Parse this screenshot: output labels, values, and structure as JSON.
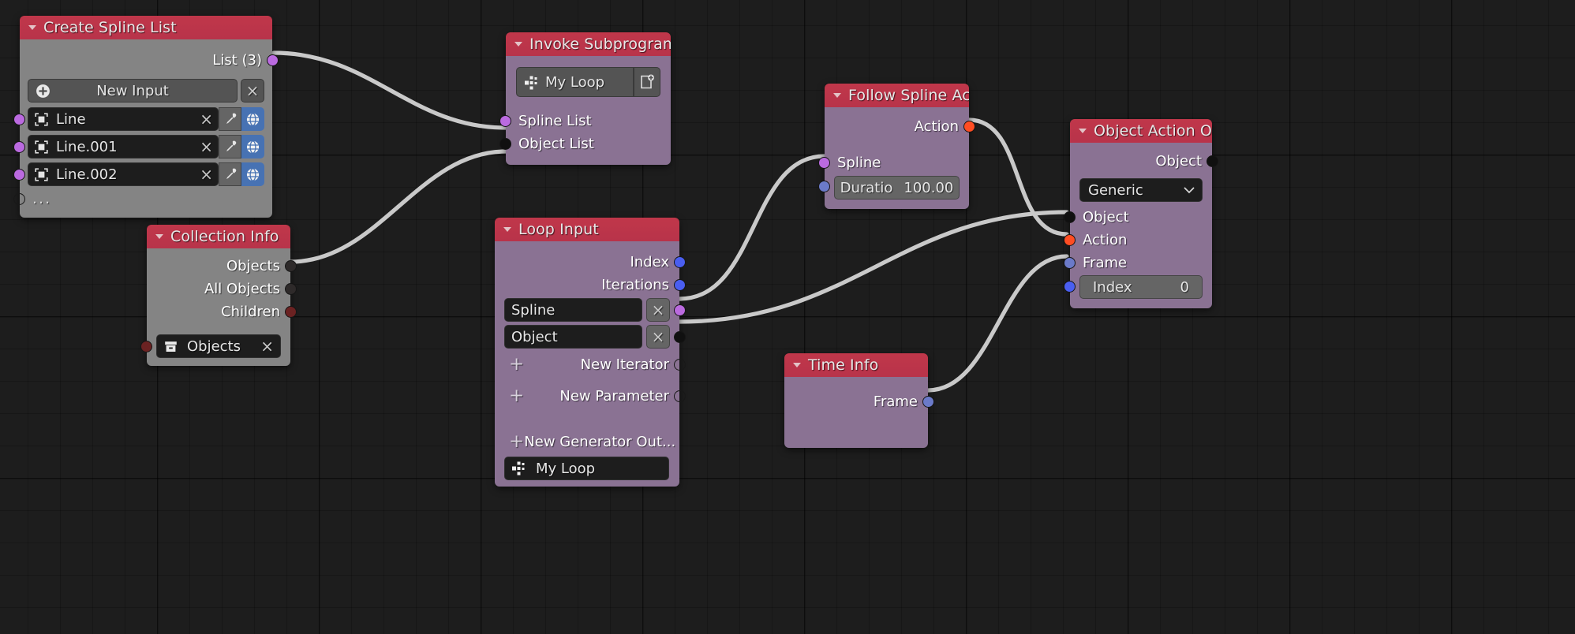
{
  "app": {
    "editor": "blender-node-editor",
    "background": "#1d1d1d"
  },
  "colors": {
    "header_red": "#bd3548",
    "body_purple": "#8a7293",
    "body_gray": "#848484",
    "socket_purple": "#bb6ae0",
    "socket_blue": "#6b7ac9",
    "socket_bright_blue": "#4a5ef0",
    "socket_black": "#101010",
    "socket_red": "#ff4d23",
    "socket_dark_red": "#6b2222",
    "wire": "#c9c9c9",
    "globe_button": "#4772b3"
  },
  "nodes": {
    "create_spline_list": {
      "title": "Create Spline List",
      "output_label": "List (3)",
      "new_input_label": "New Input",
      "items": [
        {
          "name": "Line"
        },
        {
          "name": "Line.001"
        },
        {
          "name": "Line.002"
        }
      ],
      "overflow_label": "...",
      "close_label": "×",
      "icons": {
        "collapse": "triangle-down-icon",
        "add": "plus-circle-icon",
        "object": "object-square-icon",
        "pick": "eyedropper-icon",
        "global": "globe-icon",
        "remove": "close-icon"
      }
    },
    "invoke_subprogram": {
      "title": "Invoke Subprogram",
      "subprogram": "My Loop",
      "inputs": [
        {
          "label": "Spline List",
          "socket": "purple"
        },
        {
          "label": "Object List",
          "socket": "black"
        }
      ],
      "icons": {
        "subprogram": "subprogram-icon",
        "new_subprogram": "new-file-icon"
      }
    },
    "collection_info": {
      "title": "Collection Info",
      "outputs": [
        {
          "label": "Objects",
          "socket": "dark-gray"
        },
        {
          "label": "All Objects",
          "socket": "dark-gray"
        },
        {
          "label": "Children",
          "socket": "dark-red"
        }
      ],
      "collection_field": {
        "value": "Objects",
        "close_label": "×",
        "icon": "collection-box-icon"
      }
    },
    "loop_input": {
      "title": "Loop Input",
      "outputs": [
        {
          "label": "Index",
          "socket": "blue"
        },
        {
          "label": "Iterations",
          "socket": "blue"
        }
      ],
      "iterators": [
        {
          "name": "Spline",
          "socket": "purple",
          "close_label": "×"
        },
        {
          "name": "Object",
          "socket": "black",
          "close_label": "×"
        }
      ],
      "actions": [
        {
          "label": "New Iterator",
          "plus": "+"
        },
        {
          "label": "New Parameter",
          "plus": "+"
        },
        {
          "label": "New Generator Out...",
          "plus": "+"
        }
      ],
      "subprogram": "My Loop",
      "icons": {
        "subprogram": "subprogram-icon"
      }
    },
    "follow_spline_action": {
      "title": "Follow Spline Acti",
      "outputs": [
        {
          "label": "Action",
          "socket": "red"
        }
      ],
      "inputs": [
        {
          "label": "Spline",
          "socket": "purple"
        }
      ],
      "duration": {
        "label": "Duratio",
        "value": "100.00",
        "socket": "blue"
      }
    },
    "time_info": {
      "title": "Time Info",
      "outputs": [
        {
          "label": "Frame",
          "socket": "blue"
        }
      ]
    },
    "object_action_output": {
      "title": "Object Action Ou...",
      "outputs": [
        {
          "label": "Object",
          "socket": "black"
        }
      ],
      "type_select": {
        "value": "Generic",
        "icon": "chevron-down-icon"
      },
      "inputs": [
        {
          "label": "Object",
          "socket": "black"
        },
        {
          "label": "Action",
          "socket": "red"
        },
        {
          "label": "Frame",
          "socket": "blue"
        }
      ],
      "index": {
        "label": "Index",
        "value": "0",
        "socket": "bright-blue"
      }
    }
  }
}
